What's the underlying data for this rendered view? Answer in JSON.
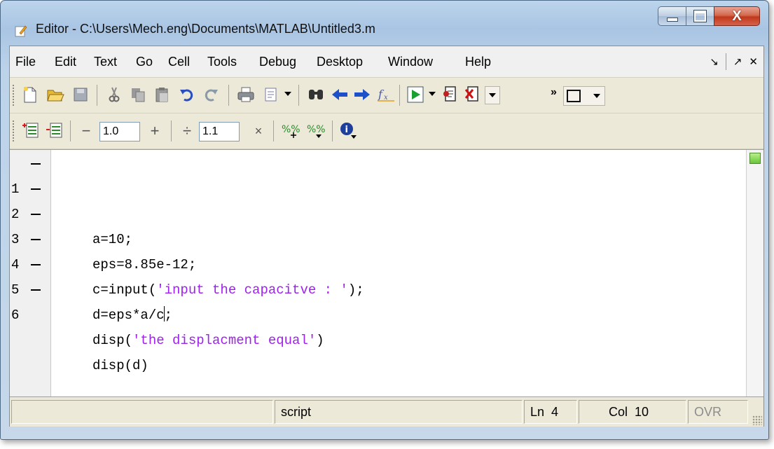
{
  "window": {
    "title": "Editor - C:\\Users\\Mech.eng\\Documents\\MATLAB\\Untitled3.m",
    "buttons": {
      "minimize": "minimize",
      "maximize": "maximize",
      "close": "X"
    }
  },
  "menubar": {
    "items": [
      "File",
      "Edit",
      "Text",
      "Go",
      "Cell",
      "Tools",
      "Debug",
      "Desktop",
      "Window",
      "Help"
    ],
    "dock": "↘",
    "undock": "↗",
    "close": "✕"
  },
  "cell_toolbar": {
    "decrement": "−",
    "value1": "1.0",
    "increment": "+",
    "divide": "÷",
    "value2": "1.1",
    "multiply": "×"
  },
  "editor": {
    "lines": [
      {
        "num": "1",
        "code": "a=10;"
      },
      {
        "num": "2",
        "code": "eps=8.85e-12;"
      },
      {
        "num": "3",
        "pre": "c=input(",
        "str": "'input the capacitve : '",
        "post": ");"
      },
      {
        "num": "4",
        "before_caret": "d=eps*a/c",
        "after_caret": ";"
      },
      {
        "num": "5",
        "pre": "disp(",
        "str": "'the displacment equal'",
        "post": ")"
      },
      {
        "num": "6",
        "code": "disp(d)"
      }
    ]
  },
  "statusbar": {
    "mode": "script",
    "ln_label": "Ln",
    "ln_value": "4",
    "col_label": "Col",
    "col_value": "10",
    "ovr": "OVR"
  },
  "colors": {
    "string": "#a020f0",
    "titlebar": "#a9c5e3",
    "status_ok": "#6ac43a"
  }
}
